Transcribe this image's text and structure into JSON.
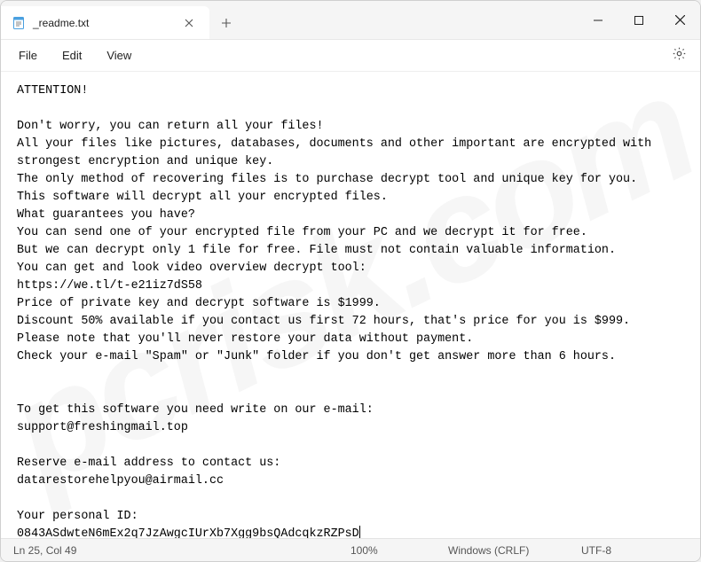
{
  "tab": {
    "title": "_readme.txt"
  },
  "menu": {
    "file": "File",
    "edit": "Edit",
    "view": "View"
  },
  "body": {
    "text": "ATTENTION!\n\nDon't worry, you can return all your files!\nAll your files like pictures, databases, documents and other important are encrypted with strongest encryption and unique key.\nThe only method of recovering files is to purchase decrypt tool and unique key for you.\nThis software will decrypt all your encrypted files.\nWhat guarantees you have?\nYou can send one of your encrypted file from your PC and we decrypt it for free.\nBut we can decrypt only 1 file for free. File must not contain valuable information.\nYou can get and look video overview decrypt tool:\nhttps://we.tl/t-e21iz7dS58\nPrice of private key and decrypt software is $1999.\nDiscount 50% available if you contact us first 72 hours, that's price for you is $999.\nPlease note that you'll never restore your data without payment.\nCheck your e-mail \"Spam\" or \"Junk\" folder if you don't get answer more than 6 hours.\n\n\nTo get this software you need write on our e-mail:\nsupport@freshingmail.top\n\nReserve e-mail address to contact us:\ndatarestorehelpyou@airmail.cc\n\nYour personal ID:\n0843ASdwteN6mEx2q7JzAwgcIUrXb7Xgg9bsQAdcqkzRZPsD"
  },
  "status": {
    "position": "Ln 25, Col 49",
    "zoom": "100%",
    "eol": "Windows (CRLF)",
    "encoding": "UTF-8"
  },
  "watermark": "pcrisk.com"
}
